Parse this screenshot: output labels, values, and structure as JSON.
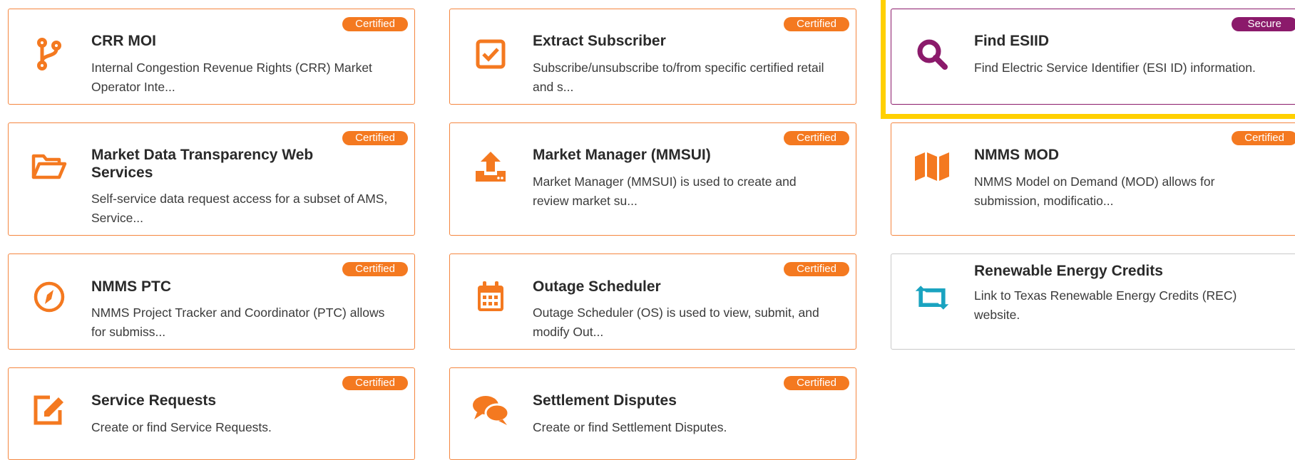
{
  "colors": {
    "certified": "#f47920",
    "secure": "#8b1a6b",
    "icon_orange": "#f47920",
    "icon_teal": "#1aa3c0",
    "highlight": "#ffd000"
  },
  "cards": [
    {
      "title": "CRR MOI",
      "description": "Internal Congestion Revenue Rights (CRR) Market Operator Inte...",
      "badge": "Certified",
      "icon": "branch-icon"
    },
    {
      "title": "Extract Subscriber",
      "description": "Subscribe/unsubscribe to/from specific certified retail and s...",
      "badge": "Certified",
      "icon": "checkbox-icon"
    },
    {
      "title": "Find ESIID",
      "description": "Find Electric Service Identifier (ESI ID) information.",
      "badge": "Secure",
      "icon": "search-icon"
    },
    {
      "title": "Market Data Transparency Web Services",
      "description": "Self-service data request access for a subset of AMS, Service...",
      "badge": "Certified",
      "icon": "folder-open-icon"
    },
    {
      "title": "Market Manager (MMSUI)",
      "description": "Market Manager (MMSUI) is used to create and review market su...",
      "badge": "Certified",
      "icon": "upload-icon"
    },
    {
      "title": "NMMS MOD",
      "description": "NMMS Model on Demand (MOD) allows for submission, modificatio...",
      "badge": "Certified",
      "icon": "map-icon"
    },
    {
      "title": "NMMS PTC",
      "description": "NMMS Project Tracker and Coordinator (PTC) allows for submiss...",
      "badge": "Certified",
      "icon": "compass-icon"
    },
    {
      "title": "Outage Scheduler",
      "description": "Outage Scheduler (OS) is used to view, submit, and modify Out...",
      "badge": "Certified",
      "icon": "calendar-icon"
    },
    {
      "title": "Renewable Energy Credits",
      "description": "Link to Texas Renewable Energy Credits (REC) website.",
      "badge": "",
      "icon": "retweet-icon"
    },
    {
      "title": "Service Requests",
      "description": "Create or find Service Requests.",
      "badge": "Certified",
      "icon": "edit-icon"
    },
    {
      "title": "Settlement Disputes",
      "description": "Create or find Settlement Disputes.",
      "badge": "Certified",
      "icon": "comments-icon"
    }
  ]
}
